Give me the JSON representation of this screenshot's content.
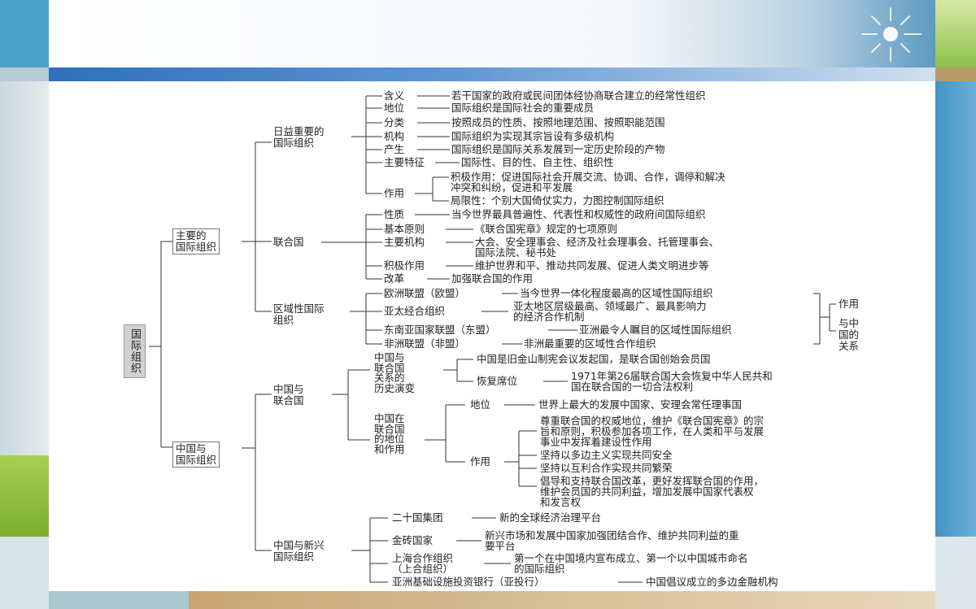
{
  "root": "国际组织",
  "branch1": {
    "label": "主要的\n国际组织",
    "sub1": {
      "label": "日益重要的\n国际组织",
      "items": [
        {
          "k": "含义",
          "v": "若干国家的政府或民间团体经协商联合建立的经常性组织"
        },
        {
          "k": "地位",
          "v": "国际组织是国际社会的重要成员"
        },
        {
          "k": "分类",
          "v": "按照成员的性质、按照地理范围、按照职能范围"
        },
        {
          "k": "机构",
          "v": "国际组织为实现其宗旨设有多级机构"
        },
        {
          "k": "产生",
          "v": "国际组织是国际关系发展到一定历史阶段的产物"
        },
        {
          "k": "主要特征",
          "v": "国际性、目的性、自主性、组织性"
        }
      ],
      "effect_label": "作用",
      "effects": [
        "积极作用：促进国际社会开展交流、协调、合作，调停和解决\n冲突和纠纷，促进和平发展",
        "局限性：个别大国倚仗实力，力图控制国际组织"
      ]
    },
    "sub2": {
      "label": "联合国",
      "items": [
        {
          "k": "性质",
          "v": "当今世界最具普遍性、代表性和权威性的政府间国际组织"
        },
        {
          "k": "基本原则",
          "v": "《联合国宪章》规定的七项原则"
        },
        {
          "k": "主要机构",
          "v": "大会、安全理事会、经济及社会理事会、托管理事会、\n国际法院、秘书处"
        },
        {
          "k": "积极作用",
          "v": "维护世界和平、推动共同发展、促进人类文明进步等"
        },
        {
          "k": "改革",
          "v": "加强联合国的作用"
        }
      ]
    },
    "sub3": {
      "label": "区域性国际\n组织",
      "items": [
        {
          "k": "欧洲联盟（欧盟）",
          "v": "当今世界一体化程度最高的区域性国际组织"
        },
        {
          "k": "亚太经合组织",
          "v": "亚太地区层级最高、领域最广、最具影响力\n的经济合作机制"
        },
        {
          "k": "东南亚国家联盟（东盟）",
          "v": "亚洲最令人瞩目的区域性国际组织"
        },
        {
          "k": "非洲联盟（非盟）",
          "v": "非洲最重要的区域性合作组织"
        }
      ],
      "side_top": "作用",
      "side_bottom": "与中\n国的\n关系"
    }
  },
  "branch2": {
    "label": "中国与\n国际组织",
    "sub1": {
      "label": "中国与\n联合国",
      "history": {
        "label": "中国与\n联合国\n关系的\n历史演变",
        "item1": "中国是旧金山制宪会议发起国，是联合国创始会员国",
        "item2_k": "恢复席位",
        "item2_v": "1971年第26届联合国大会恢复中华人民共和\n国在联合国的一切合法权利"
      },
      "status": {
        "label": "中国在\n联合国\n的地位\n和作用",
        "pos_k": "地位",
        "pos_v": "世界上最大的发展中国家、安理会常任理事国",
        "role_k": "作用",
        "roles": [
          "尊重联合国的权威地位，维护《联合国宪章》的宗\n旨和原则，积极参加各项工作，在人类和平与发展\n事业中发挥着建设性作用",
          "坚持以多边主义实现共同安全",
          "坚持以互利合作实现共同繁荣",
          "倡导和支持联合国改革，更好发挥联合国的作用，\n维护会员国的共同利益，增加发展中国家代表权\n和发言权"
        ]
      }
    },
    "sub2": {
      "label": "中国与新兴\n国际组织",
      "items": [
        {
          "k": "二十国集团",
          "v": "新的全球经济治理平台"
        },
        {
          "k": "金砖国家",
          "v": "新兴市场和发展中国家加强团结合作、维护共同利益的重\n要平台"
        },
        {
          "k": "上海合作组织\n（上合组织）",
          "v": "第一个在中国境内宣布成立、第一个以中国城市命名\n的国际组织"
        },
        {
          "k": "亚洲基础设施投资银行（亚投行）",
          "v": "中国倡议成立的多边金融机构"
        }
      ]
    }
  }
}
